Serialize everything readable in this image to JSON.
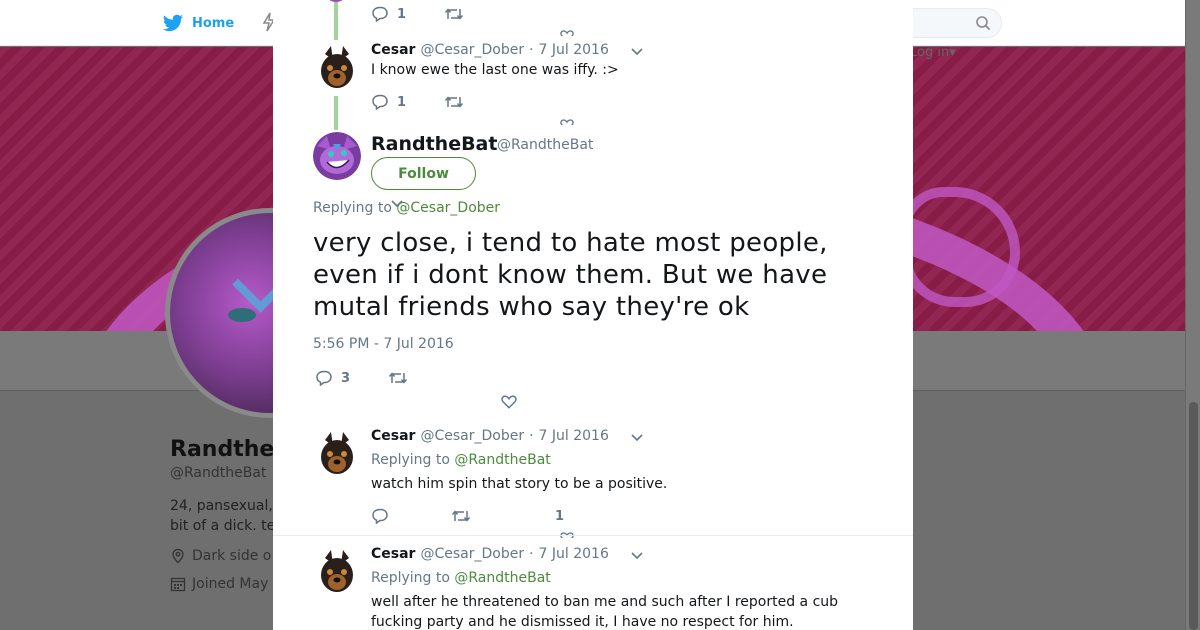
{
  "nav": {
    "home_label": "Home",
    "login_label": "Log in",
    "login_caret": "▾"
  },
  "profile": {
    "name": "Randthe",
    "handle": "@RandtheBat",
    "bio_line1": "24, pansexual,",
    "bio_line2": "bit of a dick. te",
    "location": "Dark side o",
    "joined": "Joined May"
  },
  "thread": {
    "top_tweet": {
      "reply_count": "1"
    },
    "prev_tweet": {
      "name": "Cesar",
      "handle": "@Cesar_Dober",
      "dot": "·",
      "date": "7 Jul 2016",
      "text": "I know ewe the last one was iffy. :>",
      "reply_count": "1"
    },
    "main_tweet": {
      "name": "RandtheBat",
      "handle": "@RandtheBat",
      "follow_label": "Follow",
      "replying_label": "Replying to",
      "replying_to": "@Cesar_Dober",
      "text": "very close, i tend to hate most people, even if i dont know them. But we have mutal friends who say they're ok",
      "timestamp": "5:56 PM - 7 Jul 2016",
      "reply_count": "3"
    },
    "replies": [
      {
        "name": "Cesar",
        "handle": "@Cesar_Dober",
        "dot": "·",
        "date": "7 Jul 2016",
        "replying_label": "Replying to",
        "replying_to": "@RandtheBat",
        "text": "watch him spin that story to be a positive.",
        "like_count": "1"
      },
      {
        "name": "Cesar",
        "handle": "@Cesar_Dober",
        "dot": "·",
        "date": "7 Jul 2016",
        "replying_label": "Replying to",
        "replying_to": "@RandtheBat",
        "text": "well after he threatened to ban me and such after I reported a cub fucking party and he dismissed it, I have no respect for him."
      }
    ]
  },
  "colors": {
    "link_green": "#4c8a3c",
    "thread_line": "#a3d39c",
    "muted": "#657786",
    "banner": "#8c1d4a",
    "twitter_blue": "#1da1f2"
  },
  "icons": [
    "twitter-bird-icon",
    "search-icon",
    "close-icon",
    "reply-icon",
    "retweet-icon",
    "heart-icon",
    "chevron-down-icon",
    "location-icon",
    "calendar-icon"
  ]
}
